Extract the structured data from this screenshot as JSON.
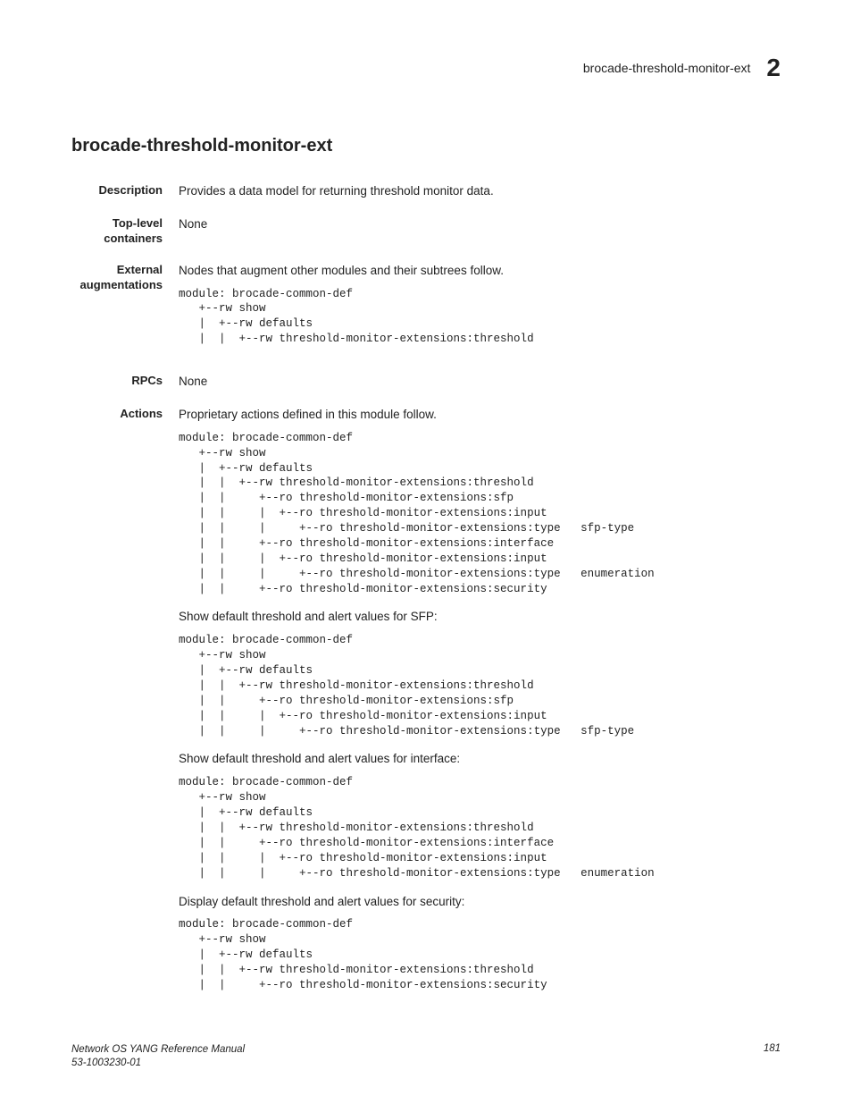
{
  "header": {
    "title": "brocade-threshold-monitor-ext",
    "chapter": "2"
  },
  "section_title": "brocade-threshold-monitor-ext",
  "fields": {
    "description": {
      "label": "Description",
      "value": "Provides a data model for returning threshold monitor data."
    },
    "top_level": {
      "label": "Top-level containers",
      "value": "None"
    },
    "external": {
      "label": "External augmentations",
      "value": "Nodes that augment other modules and their subtrees follow.",
      "code": "module: brocade-common-def\n   +--rw show\n   |  +--rw defaults\n   |  |  +--rw threshold-monitor-extensions:threshold"
    },
    "rpcs": {
      "label": "RPCs",
      "value": "None"
    },
    "actions": {
      "label": "Actions",
      "value": "Proprietary actions defined in this module follow.",
      "code1": "module: brocade-common-def\n   +--rw show\n   |  +--rw defaults\n   |  |  +--rw threshold-monitor-extensions:threshold\n   |  |     +--ro threshold-monitor-extensions:sfp\n   |  |     |  +--ro threshold-monitor-extensions:input\n   |  |     |     +--ro threshold-monitor-extensions:type   sfp-type\n   |  |     +--ro threshold-monitor-extensions:interface\n   |  |     |  +--ro threshold-monitor-extensions:input\n   |  |     |     +--ro threshold-monitor-extensions:type   enumeration\n   |  |     +--ro threshold-monitor-extensions:security",
      "para2": "Show default threshold and alert values for SFP:",
      "code2": "module: brocade-common-def\n   +--rw show\n   |  +--rw defaults\n   |  |  +--rw threshold-monitor-extensions:threshold\n   |  |     +--ro threshold-monitor-extensions:sfp\n   |  |     |  +--ro threshold-monitor-extensions:input\n   |  |     |     +--ro threshold-monitor-extensions:type   sfp-type",
      "para3": "Show default threshold and alert values for interface:",
      "code3": "module: brocade-common-def\n   +--rw show\n   |  +--rw defaults\n   |  |  +--rw threshold-monitor-extensions:threshold\n   |  |     +--ro threshold-monitor-extensions:interface\n   |  |     |  +--ro threshold-monitor-extensions:input\n   |  |     |     +--ro threshold-monitor-extensions:type   enumeration",
      "para4": "Display default threshold and alert values for security:",
      "code4": "module: brocade-common-def\n   +--rw show\n   |  +--rw defaults\n   |  |  +--rw threshold-monitor-extensions:threshold\n   |  |     +--ro threshold-monitor-extensions:security"
    }
  },
  "footer": {
    "manual": "Network OS YANG Reference Manual",
    "docnum": "53-1003230-01",
    "page": "181"
  }
}
